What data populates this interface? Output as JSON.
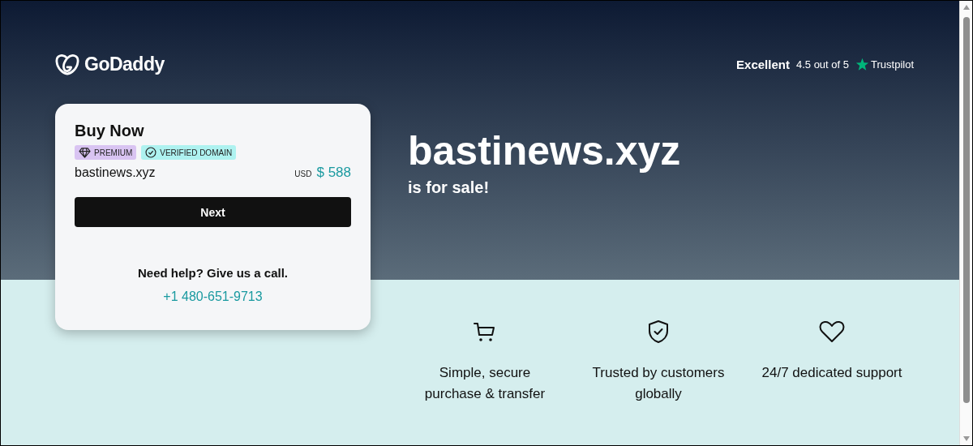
{
  "header": {
    "logo": "GoDaddy",
    "rating": {
      "label": "Excellent",
      "score": "4.5 out of 5",
      "brand": "Trustpilot"
    }
  },
  "card": {
    "title": "Buy Now",
    "badges": [
      {
        "kind": "premium",
        "label": "PREMIUM"
      },
      {
        "kind": "verified",
        "label": "VERIFIED DOMAIN"
      }
    ],
    "domain": "bastinews.xyz",
    "currency": "USD",
    "price": "$ 588",
    "button": "Next",
    "help": "Need help? Give us a call.",
    "phone": "+1 480-651-9713"
  },
  "hero": {
    "domain": "bastinews.xyz",
    "subtitle": "is for sale!"
  },
  "features": [
    {
      "kind": "cart",
      "text": "Simple, secure purchase & transfer"
    },
    {
      "kind": "shield",
      "text": "Trusted by customers globally"
    },
    {
      "kind": "heart",
      "text": "24/7 dedicated support"
    }
  ]
}
